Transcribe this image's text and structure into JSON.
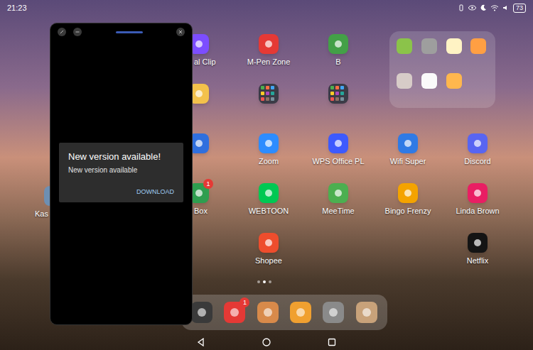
{
  "status_bar": {
    "time": "21:23",
    "battery": "73"
  },
  "floating_window": {
    "dialog": {
      "title": "New version available!",
      "message": "New version available",
      "button": "DOWNLOAD"
    }
  },
  "home_screen": {
    "left_edge_app": {
      "label": "Kas",
      "color": "#6d8fb3"
    },
    "rows": [
      [
        {
          "kind": "app",
          "label": "al Clip",
          "color": "#7c4dff",
          "badge": ""
        },
        {
          "kind": "app",
          "label": "M-Pen Zone",
          "color": "#e53935",
          "badge": ""
        },
        {
          "kind": "app",
          "label": "B",
          "color": "#43a047",
          "badge": ""
        }
      ],
      [
        {
          "kind": "app",
          "label": "",
          "color": "#f3c14b",
          "badge": ""
        },
        {
          "kind": "folder",
          "label": "",
          "color": "#3b3b46",
          "badge": ""
        },
        {
          "kind": "folder",
          "label": "",
          "color": "#3b3b46",
          "badge": ""
        }
      ],
      [
        {
          "kind": "app",
          "label": "",
          "color": "#2f6fde",
          "badge": ""
        },
        {
          "kind": "app",
          "label": "Zoom",
          "color": "#2d8cff",
          "badge": ""
        },
        {
          "kind": "app",
          "label": "WPS Office PL",
          "color": "#3d5afe",
          "badge": ""
        },
        {
          "kind": "app",
          "label": "Wifi Super",
          "color": "#2f7ae5",
          "badge": ""
        },
        {
          "kind": "app",
          "label": "Discord",
          "color": "#5865f2",
          "badge": ""
        }
      ],
      [
        {
          "kind": "app",
          "label": "Box",
          "color": "#2e9e4f",
          "badge": "1"
        },
        {
          "kind": "app",
          "label": "WEBTOON",
          "color": "#00c853",
          "badge": ""
        },
        {
          "kind": "app",
          "label": "MeeTime",
          "color": "#4caf50",
          "badge": ""
        },
        {
          "kind": "app",
          "label": "Bingo Frenzy",
          "color": "#f4a300",
          "badge": ""
        },
        {
          "kind": "app",
          "label": "Linda Brown",
          "color": "#e91e63",
          "badge": ""
        }
      ],
      [
        {
          "kind": "empty",
          "label": "",
          "color": "#000000",
          "badge": ""
        },
        {
          "kind": "app",
          "label": "Shopee",
          "color": "#ee4d2d",
          "badge": ""
        },
        {
          "kind": "empty",
          "label": "",
          "color": "#000000",
          "badge": ""
        },
        {
          "kind": "empty",
          "label": "",
          "color": "#000000",
          "badge": ""
        },
        {
          "kind": "app",
          "label": "Netflix",
          "color": "#141414",
          "badge": ""
        }
      ]
    ],
    "folder_widget": {
      "apps": [
        {
          "color": "#8bc34a"
        },
        {
          "color": "#9e9e9e"
        },
        {
          "color": "#fff3c4"
        },
        {
          "color": "#ff9f43"
        },
        {
          "color": "#d7ccc8"
        },
        {
          "color": "#fafafa"
        },
        {
          "color": "#ffb74d"
        }
      ]
    },
    "page_indicator": [
      {
        "selected": false
      },
      {
        "selected": true
      },
      {
        "selected": false
      }
    ]
  },
  "dock": [
    {
      "color": "#3a3a3a",
      "badge": ""
    },
    {
      "color": "#e53935",
      "badge": "1"
    },
    {
      "color": "#d88a4a",
      "badge": ""
    },
    {
      "color": "#f0a030",
      "badge": ""
    },
    {
      "color": "#8a8a8a",
      "badge": ""
    },
    {
      "color": "#c8a27a",
      "badge": ""
    }
  ]
}
